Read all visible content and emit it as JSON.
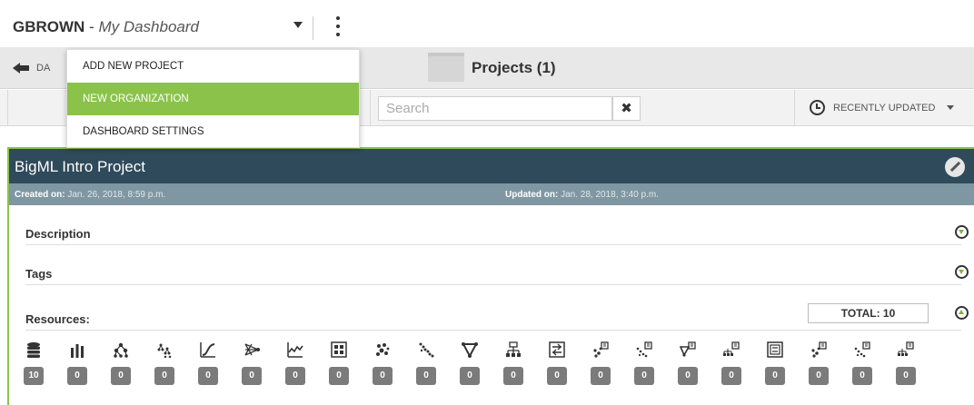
{
  "workspace": {
    "user": "GBROWN",
    "separator": " - ",
    "dashboard": "My Dashboard"
  },
  "menu": {
    "items": [
      {
        "label": "ADD NEW PROJECT"
      },
      {
        "label": "NEW ORGANIZATION",
        "active": true
      },
      {
        "label": "DASHBOARD SETTINGS"
      }
    ]
  },
  "header": {
    "back_label": "DA",
    "title": "Projects (1)"
  },
  "search": {
    "placeholder": "Search",
    "value": "",
    "clear_icon": "close-icon"
  },
  "sort": {
    "label": "RECENTLY UPDATED",
    "icon": "clock-icon"
  },
  "project": {
    "name": "BigML Intro Project",
    "created_key": "Created on:",
    "created_value": "Jan. 26, 2018, 8:59 p.m.",
    "updated_key": "Updated on:",
    "updated_value": "Jan. 28, 2018, 3:40 p.m.",
    "sections": {
      "description": "Description",
      "tags": "Tags",
      "resources": "Resources:"
    },
    "total_label": "TOTAL: 10",
    "resources": [
      {
        "icon": "database-icon",
        "count": "10"
      },
      {
        "icon": "bar-chart-icon",
        "count": "0"
      },
      {
        "icon": "model-tree-icon",
        "count": "0"
      },
      {
        "icon": "ensemble-icon",
        "count": "0"
      },
      {
        "icon": "logistic-curve-icon",
        "count": "0"
      },
      {
        "icon": "deepnet-icon",
        "count": "0"
      },
      {
        "icon": "time-series-icon",
        "count": "0"
      },
      {
        "icon": "grid-icon",
        "count": "0"
      },
      {
        "icon": "cluster-icon",
        "count": "0"
      },
      {
        "icon": "anomaly-icon",
        "count": "0"
      },
      {
        "icon": "association-icon",
        "count": "0"
      },
      {
        "icon": "topic-model-icon",
        "count": "0"
      },
      {
        "icon": "evaluation-icon",
        "count": "0"
      },
      {
        "icon": "batch-cluster-icon",
        "count": "0"
      },
      {
        "icon": "batch-anomaly-icon",
        "count": "0"
      },
      {
        "icon": "batch-association-icon",
        "count": "0"
      },
      {
        "icon": "batch-topic-icon",
        "count": "0"
      },
      {
        "icon": "batch-evaluation-icon",
        "count": "0"
      },
      {
        "icon": "centroid-icon",
        "count": "0"
      },
      {
        "icon": "anomaly-score-icon",
        "count": "0"
      },
      {
        "icon": "prediction-icon",
        "count": "0"
      }
    ]
  },
  "colors": {
    "accent_green": "#8bc34a",
    "card_header": "#2f4a5a",
    "meta_bar": "#7f97a2",
    "count_badge": "#7b7b7b"
  }
}
